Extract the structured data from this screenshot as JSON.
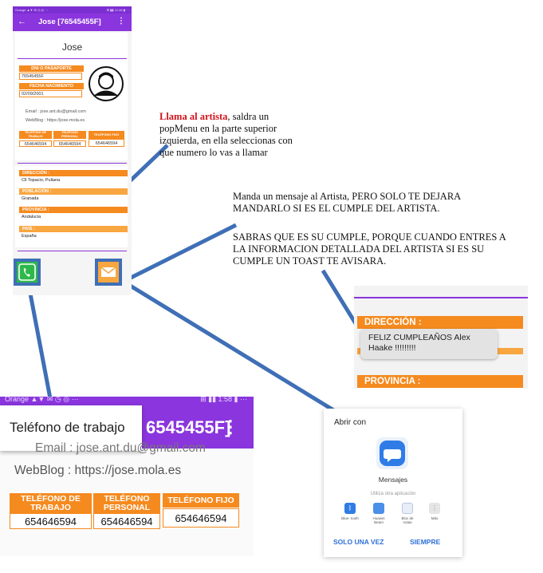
{
  "phone": {
    "status_left": "Orange ▲▼ ✉ ◷ ◎ ···",
    "status_right": "⊞ ▮▮ 12:48 ▮ ···",
    "title": "Jose  [76545455F]",
    "name": "Jose",
    "dni_label": "DNI O PASAPORTE",
    "dni_value": "76545455F",
    "fecha_label": "FECHA NACIMIENTO",
    "fecha_value": "02/09/2001",
    "email": "Email :   jose.ant.du@gmail.com",
    "weblog": "WebBlog : https://jose.mola.es",
    "tel_trabajo_label": "TELÉFONO DE TRABAJO",
    "tel_personal_label": "TELÉFONO PERSONAL",
    "tel_fijo_label": "TELÉFONO FIJO",
    "tel_trabajo": "654646594",
    "tel_personal": "654646594",
    "tel_fijo": "654646594",
    "direccion_label": "DIRECCIÓN :",
    "direccion": "Cll Topacio, Puliana",
    "poblacion_label": "POBLACIÓN :",
    "poblacion": "Granada",
    "provincia_label": "PROVINCIA :",
    "provincia": "Andalucia",
    "pais_label": "PAÍS :",
    "pais": "España"
  },
  "annotations": {
    "call_bold": "Llama al artista",
    "call_rest": ", saldra un popMenu en la parte superior izquierda, en ella seleccionas con que numero lo vas a llamar",
    "message_1": "Manda un mensaje al Artista, PERO SOLO TE DEJARA MANDARLO SI ES EL CUMPLE DEL ARTISTA.",
    "message_2": "SABRAS QUE ES SU CUMPLE, PORQUE CUANDO ENTRES A LA INFORMACION DETALLADA DEL ARTISTA SI ES SU CUMPLE UN TOAST TE AVISARA."
  },
  "toast_shot": {
    "direccion_label": "DIRECCIÓN :",
    "toast": "FELIZ CUMPLEAÑOS Alex Haake  !!!!!!!!!",
    "provincia_label": "PROVINCIA :"
  },
  "zoom": {
    "status_left": "Orange ▲▼ ✉ ◷ ◎ ···",
    "status_right": "⊞ ▮▮ 1:58 ▮ ···",
    "title_fragment": "6545455F]",
    "popup_item": "Teléfono de trabajo",
    "email_fragment": "Email :   jose.ant.du@gmail.com",
    "weblog": "WebBlog : https://jose.mola.es",
    "tel_trabajo_label": "TELÉFONO DE TRABAJO",
    "tel_personal_label": "TELÉFONO PERSONAL",
    "tel_fijo_label": "TELÉFONO FIJO",
    "tel_trabajo": "654646594",
    "tel_personal": "654646594",
    "tel_fijo": "654646594"
  },
  "share": {
    "title": "Abrir con",
    "app_name": "Mensajes",
    "other": "Utiliza otra aplicación",
    "apps": [
      "Blue- tooth",
      "Huawei Beam",
      "Bloc de notas",
      "Más"
    ],
    "once": "SOLO UNA VEZ",
    "always": "SIEMPRE"
  },
  "colors": {
    "purple": "#8a35dd",
    "orange": "#f58a1f",
    "green": "#2db84c",
    "arrow_blue": "#3f6fb6",
    "annotation_red": "#d0121b"
  }
}
